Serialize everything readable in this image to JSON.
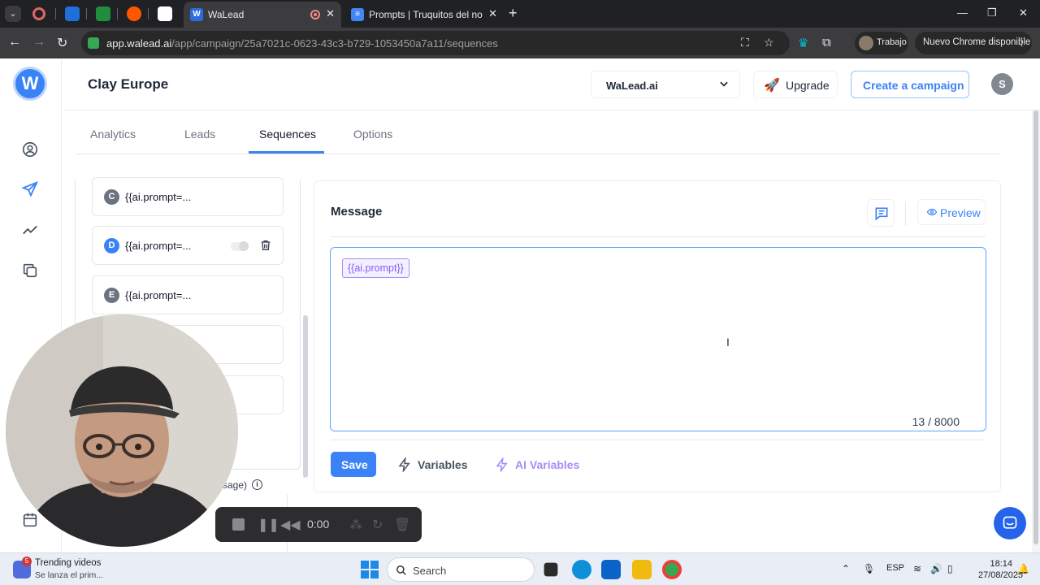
{
  "browser": {
    "tabs": [
      {
        "title": "WaLead",
        "active": true
      },
      {
        "title": "Prompts | Truquitos del nombre",
        "active": false
      }
    ],
    "url_host": "app.walead.ai",
    "url_path": "/app/campaign/25a7021c-0623-43c3-b729-1053450a7a11/sequences",
    "profile_label": "Trabajo",
    "update_label": "Nuevo Chrome disponible"
  },
  "app": {
    "logo_letter": "W",
    "page_title": "Clay Europe",
    "workspace": "WaLead.ai",
    "upgrade_label": "Upgrade",
    "create_campaign_label": "Create a campaign",
    "user_initial": "S",
    "tabs": [
      {
        "label": "Analytics"
      },
      {
        "label": "Leads"
      },
      {
        "label": "Sequences"
      },
      {
        "label": "Options"
      }
    ],
    "active_tab": "Sequences",
    "steps": [
      {
        "letter": "C",
        "text": "{{ai.prompt=..."
      },
      {
        "letter": "D",
        "text": "{{ai.prompt=..."
      },
      {
        "letter": "E",
        "text": "{{ai.prompt=..."
      }
    ],
    "below_steps_text": "ssage)",
    "message": {
      "title": "Message",
      "preview_label": "Preview",
      "chip_text": "{{ai.prompt}}",
      "char_count": "13 / 8000",
      "save_label": "Save",
      "variables_label": "Variables",
      "ai_variables_label": "AI Variables"
    }
  },
  "recorder": {
    "time": "0:00"
  },
  "taskbar": {
    "news_badge": "5",
    "news_title": "Trending videos",
    "news_sub": "Se lanza el prim...",
    "search_label": "Search",
    "lang": "ESP",
    "time": "18:14",
    "date": "27/08/2025"
  },
  "colors": {
    "accent": "#3b82f6",
    "ai_purple": "#a78bfa",
    "browser_dark": "#202124"
  }
}
